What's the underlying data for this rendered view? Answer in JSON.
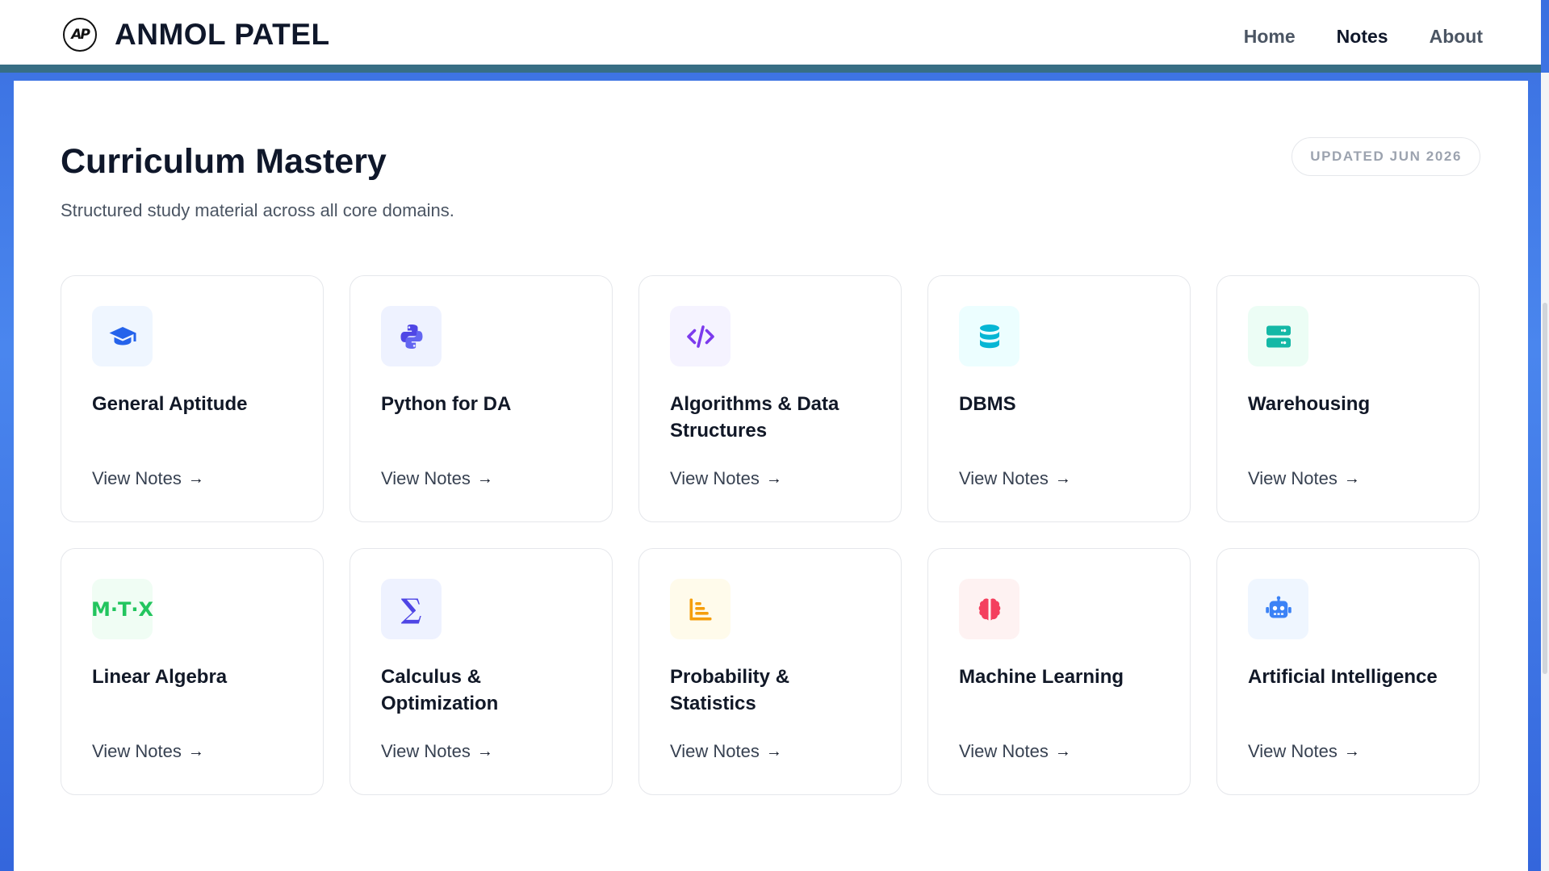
{
  "header": {
    "logo_text": "AP",
    "brand": "ANMOL PATEL",
    "nav": [
      {
        "label": "Home",
        "active": false
      },
      {
        "label": "Notes",
        "active": true
      },
      {
        "label": "About",
        "active": false
      }
    ]
  },
  "main": {
    "title": "Curriculum Mastery",
    "subtitle": "Structured study material across all core domains.",
    "badge": "UPDATED JUN 2026",
    "cards": [
      {
        "title": "General Aptitude",
        "link": "View Notes",
        "icon": "graduation-cap-icon",
        "icon_bg": "#eff6ff",
        "icon_color": "#2563eb"
      },
      {
        "title": "Python for DA",
        "link": "View Notes",
        "icon": "python-icon",
        "icon_bg": "#eef2ff",
        "icon_color": "#4f46e5"
      },
      {
        "title": "Algorithms & Data Structures",
        "link": "View Notes",
        "icon": "code-icon",
        "icon_bg": "#f5f3ff",
        "icon_color": "#7c3aed"
      },
      {
        "title": "DBMS",
        "link": "View Notes",
        "icon": "database-icon",
        "icon_bg": "#ecfeff",
        "icon_color": "#06b6d4"
      },
      {
        "title": "Warehousing",
        "link": "View Notes",
        "icon": "server-icon",
        "icon_bg": "#ecfdf5",
        "icon_color": "#14b8a6"
      },
      {
        "title": "Linear Algebra",
        "link": "View Notes",
        "icon": "matrix-icon",
        "icon_text": "M·T·X",
        "icon_bg": "#f0fdf4",
        "icon_color": "#22c55e"
      },
      {
        "title": "Calculus & Optimization",
        "link": "View Notes",
        "icon": "sigma-icon",
        "icon_text": "∑",
        "icon_bg": "#eef2ff",
        "icon_color": "#4f46e5"
      },
      {
        "title": "Probability & Statistics",
        "link": "View Notes",
        "icon": "chart-icon",
        "icon_bg": "#fffbeb",
        "icon_color": "#f59e0b"
      },
      {
        "title": "Machine Learning",
        "link": "View Notes",
        "icon": "brain-icon",
        "icon_bg": "#fef2f2",
        "icon_color": "#f43f5e"
      },
      {
        "title": "Artificial Intelligence",
        "link": "View Notes",
        "icon": "robot-icon",
        "icon_bg": "#eff6ff",
        "icon_color": "#3b82f6"
      }
    ]
  }
}
